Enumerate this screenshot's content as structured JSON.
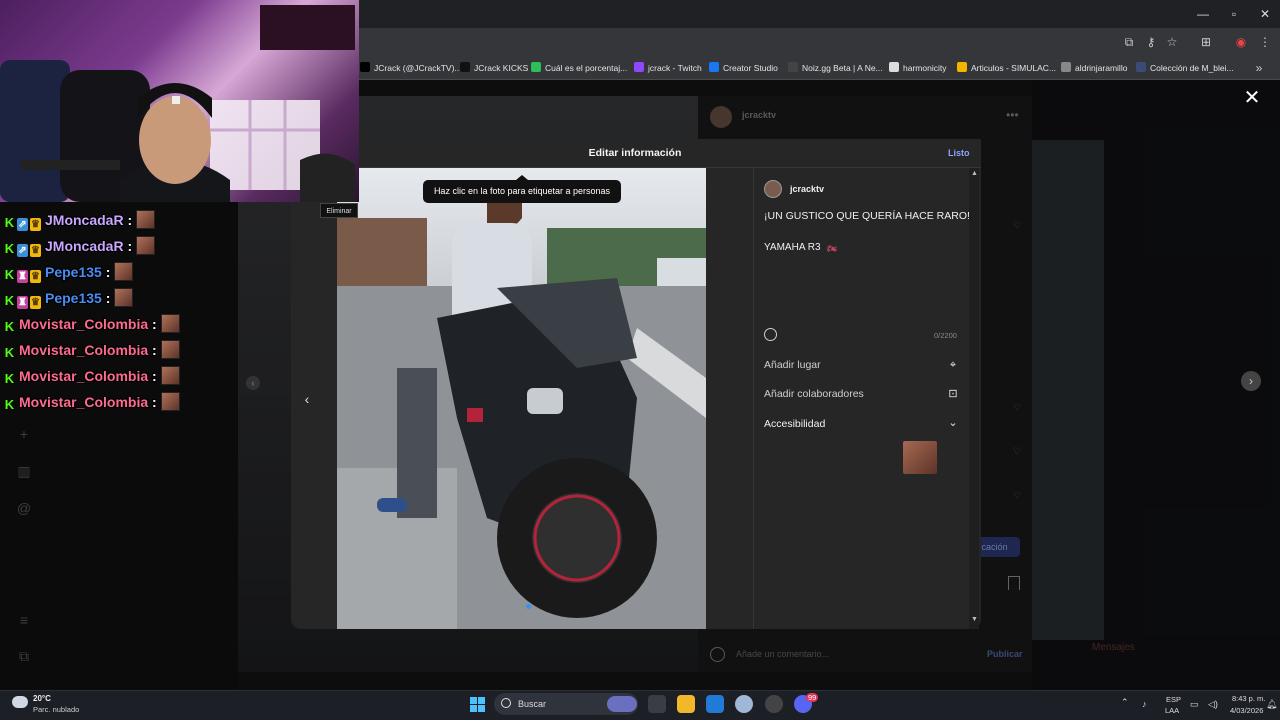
{
  "browser": {
    "bookmarks": [
      {
        "label": "JCrack (@JCrackTV)...",
        "icon": "x-icon",
        "color": "#000000"
      },
      {
        "label": "JCrack KICKS",
        "icon": "kick-icon",
        "color": "#111111"
      },
      {
        "label": "Cuál es el porcentaj...",
        "icon": "d-icon",
        "color": "#2fbf5a"
      },
      {
        "label": "jcrack - Twitch",
        "icon": "twitch-icon",
        "color": "#9146ff"
      },
      {
        "label": "Creator Studio",
        "icon": "facebook-icon",
        "color": "#1877f2"
      },
      {
        "label": "Noiz.gg Beta | A Ne...",
        "icon": "noiz-icon",
        "color": "#444444"
      },
      {
        "label": "harmonicity",
        "icon": "h-icon",
        "color": "#dddddd"
      },
      {
        "label": "Articulos - SIMULAC...",
        "icon": "drive-icon",
        "color": "#f4b400"
      },
      {
        "label": "aldrinjaramillo",
        "icon": "page-icon",
        "color": "#888888"
      },
      {
        "label": "Colección de M_blei...",
        "icon": "globe-icon",
        "color": "#3c4a78"
      }
    ]
  },
  "background_post": {
    "username": "jcracktv",
    "comment_placeholder": "Añade un comentario...",
    "publish_label": "Publicar",
    "button_fragment": "olicación",
    "messages_label": "Mensajes"
  },
  "modal": {
    "title": "Editar información",
    "done_label": "Listo",
    "tag_tooltip": "Haz clic en la foto para etiquetar a personas",
    "username": "jcracktv",
    "caption_line1": "¡UN GUSTICO QUE QUERÍA HACE RARO!",
    "caption_line2": "YAMAHA R3",
    "caption_emoji": "🏍",
    "char_counter": "0/2200",
    "add_location": "Añadir lugar",
    "add_collaborators": "Añadir colaboradores",
    "accessibility": "Accesibilidad",
    "delete_tooltip": "Eliminar"
  },
  "chat": [
    {
      "user": "JMoncadaR",
      "color": "#c9a6ff",
      "badges": [
        "k",
        "sub",
        "crown"
      ]
    },
    {
      "user": "JMoncadaR",
      "color": "#c9a6ff",
      "badges": [
        "k",
        "sub",
        "crown"
      ]
    },
    {
      "user": "Pepe135",
      "color": "#4a8cf0",
      "badges": [
        "k",
        "og",
        "crown"
      ]
    },
    {
      "user": "Pepe135",
      "color": "#4a8cf0",
      "badges": [
        "k",
        "og",
        "crown"
      ]
    },
    {
      "user": "Movistar_Colombia",
      "color": "#ff6b8e",
      "badges": [
        "k"
      ]
    },
    {
      "user": "Movistar_Colombia",
      "color": "#ff6b8e",
      "badges": [
        "k"
      ]
    },
    {
      "user": "Movistar_Colombia",
      "color": "#ff6b8e",
      "badges": [
        "k"
      ]
    },
    {
      "user": "Movistar_Colombia",
      "color": "#ff6b8e",
      "badges": [
        "k"
      ]
    }
  ],
  "taskbar": {
    "weather_temp": "20°C",
    "weather_desc": "Parc. nublado",
    "search_label": "Buscar",
    "lang_top": "ESP",
    "lang_bottom": "LAA",
    "time": "8:43 p. m.",
    "date": "4/03/2026",
    "discord_badge": "99"
  }
}
